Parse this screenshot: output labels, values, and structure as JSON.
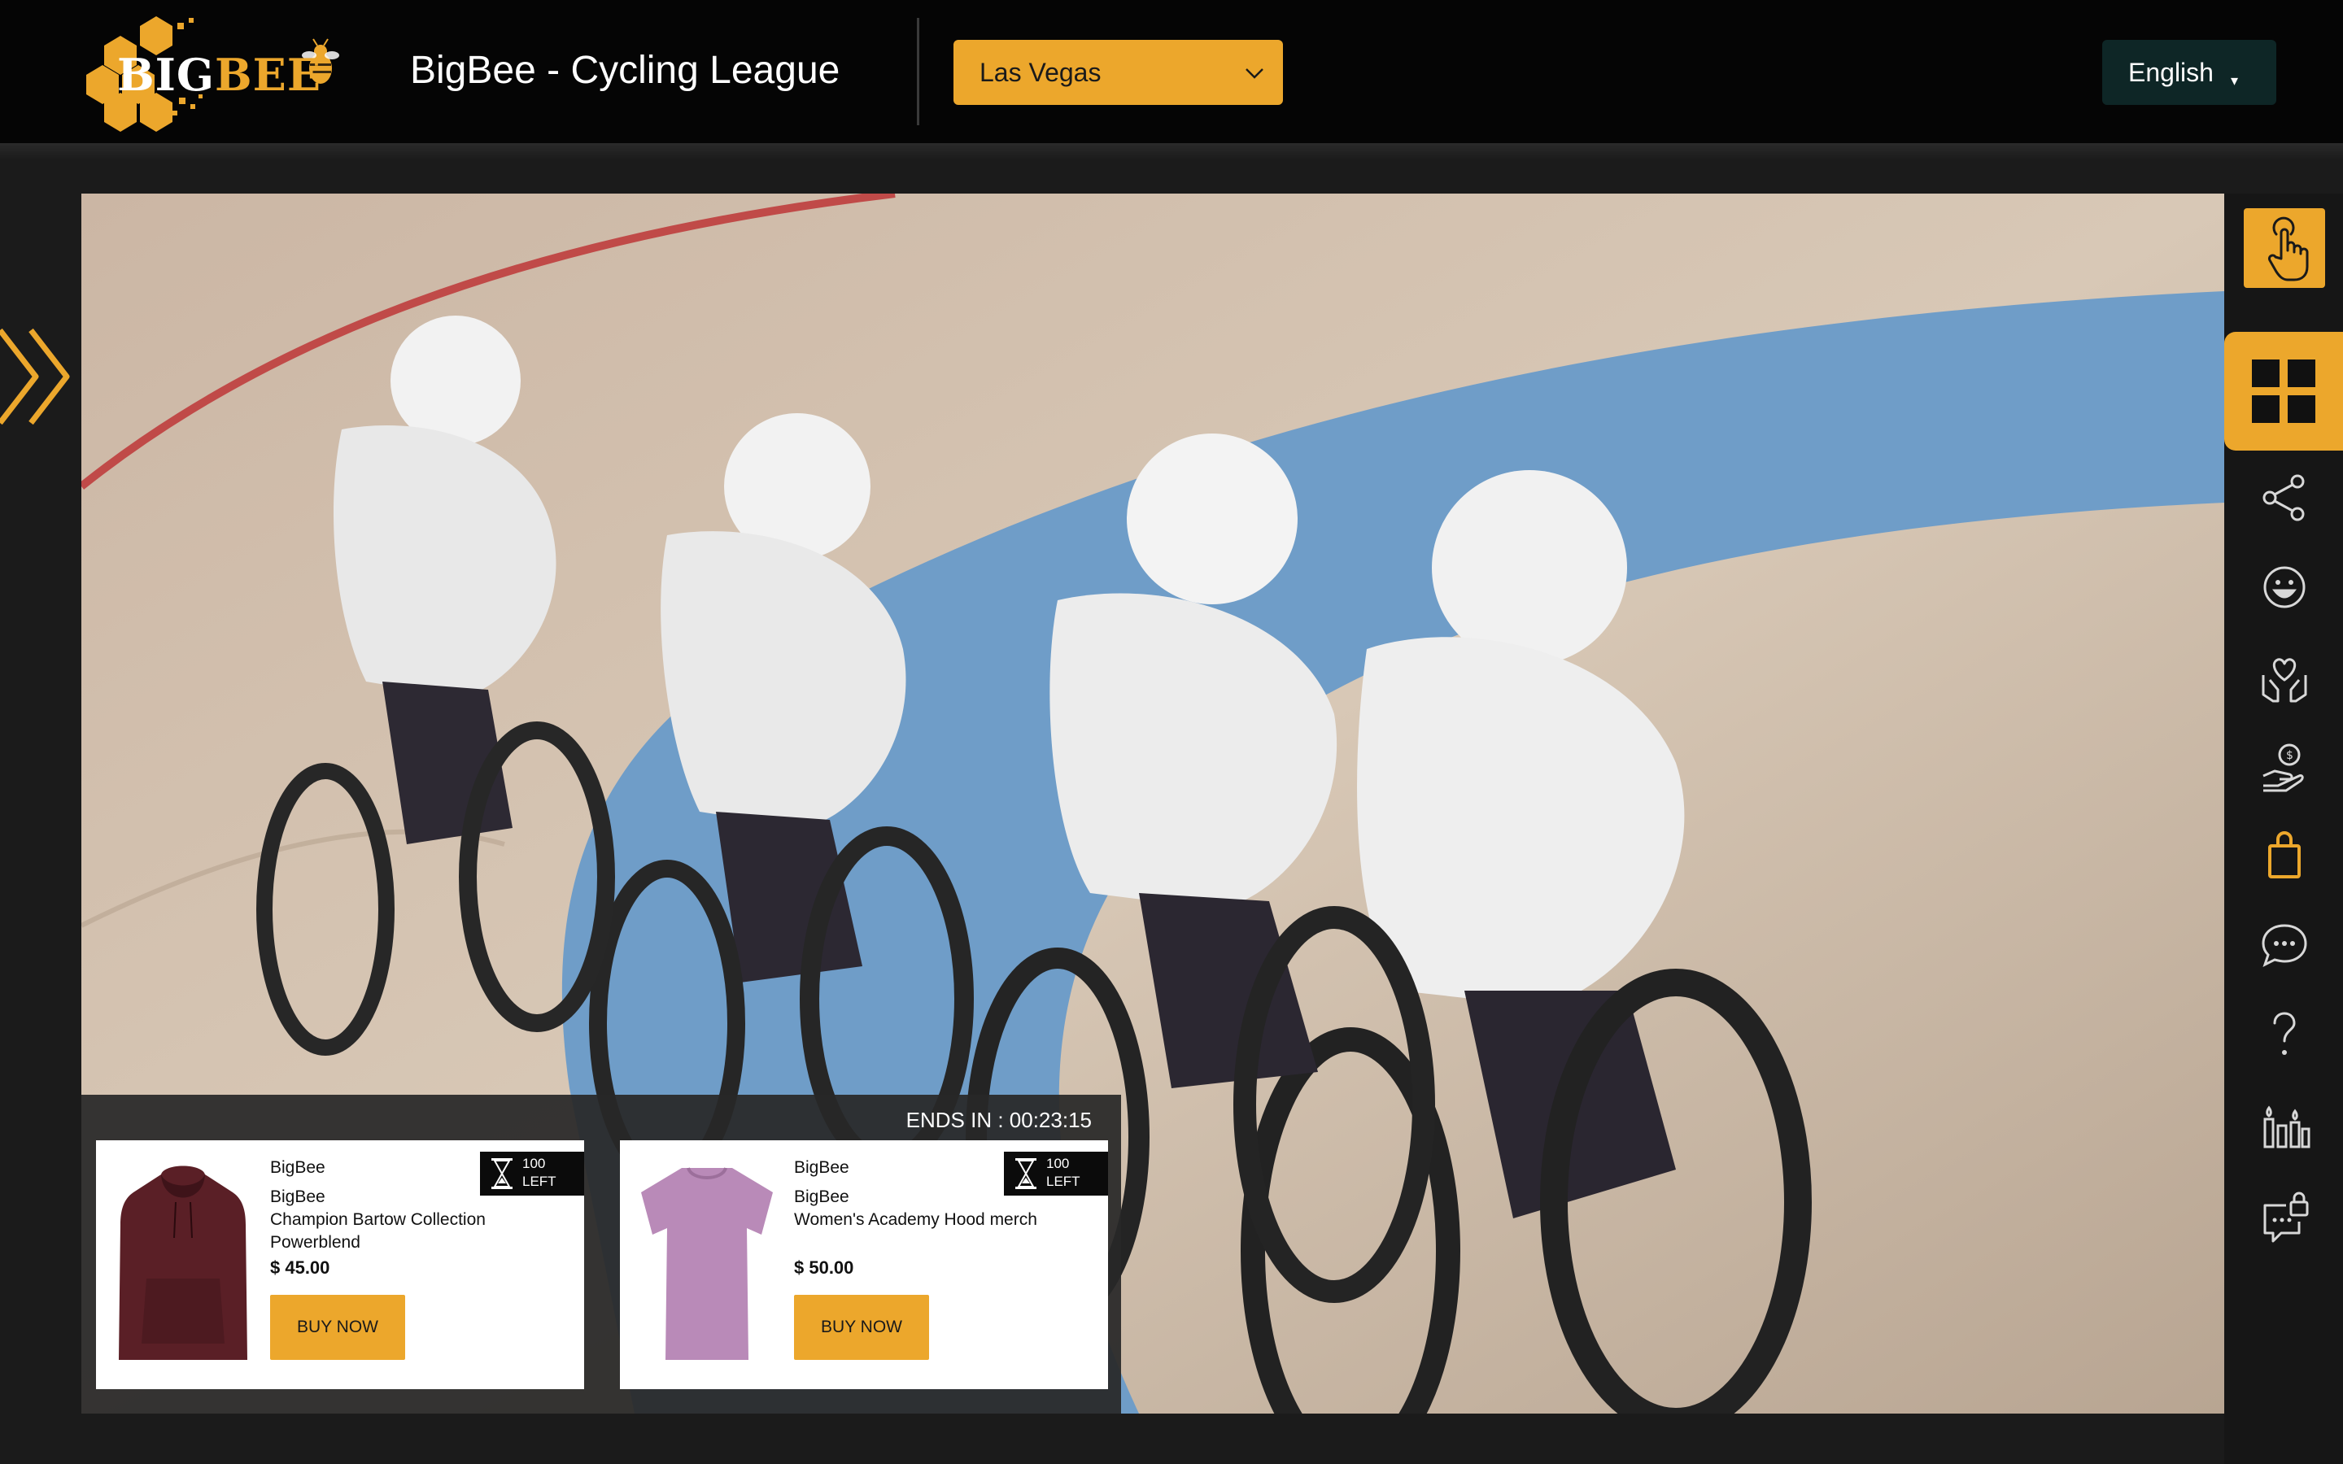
{
  "header": {
    "logo": {
      "text_big": "BIG",
      "text_bee": "BEE",
      "icon": "bee-icon"
    },
    "title": "BigBee - Cycling League",
    "city_select": {
      "selected": "Las Vegas",
      "icon": "chevron-down-icon"
    },
    "language": {
      "label": "English",
      "caret": "▾"
    }
  },
  "sidebar_toggle": {
    "icon": "double-chevron-right-icon"
  },
  "video": {
    "description_icon": "video-frame"
  },
  "toolbar": {
    "items": [
      {
        "name": "tap",
        "icon": "hand-tap-icon",
        "active": true
      },
      {
        "name": "grid",
        "icon": "grid-icon",
        "active": true
      },
      {
        "name": "share",
        "icon": "share-icon"
      },
      {
        "name": "emoji",
        "icon": "smiley-icon"
      },
      {
        "name": "donate",
        "icon": "heart-hands-icon"
      },
      {
        "name": "tip",
        "icon": "hand-coin-icon"
      },
      {
        "name": "shop",
        "icon": "shopping-bag-icon"
      },
      {
        "name": "chat",
        "icon": "chat-bubble-icon"
      },
      {
        "name": "help",
        "icon": "question-mark-icon"
      },
      {
        "name": "stats",
        "icon": "candles-icon"
      },
      {
        "name": "private-chat",
        "icon": "locked-chat-icon"
      }
    ]
  },
  "shop": {
    "countdown": "ENDS IN : 00:23:15",
    "products": [
      {
        "brand": "BigBee",
        "seller": "BigBee",
        "name": "Champion Bartow Collection Powerblend",
        "price": "$ 45.00",
        "stock_count": "100",
        "stock_label": "LEFT",
        "buy_label": "BUY NOW",
        "color": "#5a1f26"
      },
      {
        "brand": "BigBee",
        "seller": "BigBee",
        "name": "Women's Academy Hood merch",
        "price": "$ 50.00",
        "stock_count": "100",
        "stock_label": "LEFT",
        "buy_label": "BUY NOW",
        "color": "#b98ab8"
      }
    ]
  },
  "colors": {
    "accent": "#eca72c",
    "header_bg": "#050505",
    "language_bg": "#0e2626"
  }
}
